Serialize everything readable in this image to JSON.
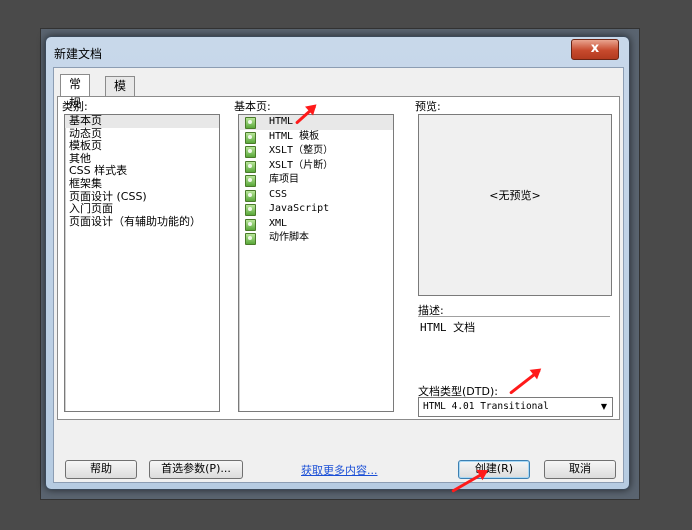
{
  "dialog": {
    "title": "新建文档",
    "close_label": "x"
  },
  "tabs": [
    {
      "label": "常规"
    },
    {
      "label": "模板"
    }
  ],
  "category": {
    "label": "类别:",
    "items": [
      "基本页",
      "动态页",
      "模板页",
      "其他",
      "CSS 样式表",
      "框架集",
      "页面设计 (CSS)",
      "入门页面",
      "页面设计（有辅助功能的）"
    ]
  },
  "basic_page": {
    "label": "基本页:",
    "items": [
      "HTML",
      "HTML 模板",
      "XSLT（整页）",
      "XSLT（片断）",
      "库项目",
      "CSS",
      "JavaScript",
      "XML",
      "动作脚本"
    ]
  },
  "preview": {
    "label": "预览:",
    "placeholder": "<无预览>"
  },
  "description": {
    "label": "描述:",
    "text": "HTML 文档"
  },
  "doctype": {
    "label": "文档类型(DTD):",
    "value": "HTML 4.01 Transitional"
  },
  "buttons": {
    "help": "帮助",
    "preferences": "首选参数(P)...",
    "get_more": "获取更多内容...",
    "create": "创建(R)",
    "cancel": "取消"
  }
}
